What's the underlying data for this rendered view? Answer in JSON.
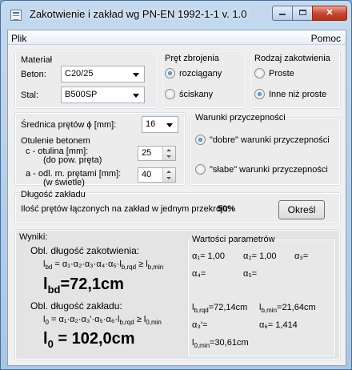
{
  "window": {
    "title": "Zakotwienie i zakład wg PN-EN 1992-1-1 v. 1.0",
    "close_glyph": "✕"
  },
  "menu": {
    "items": [
      "Plik",
      "Pomoc"
    ]
  },
  "material": {
    "title": "Materiał",
    "beton_label": "Beton:",
    "beton_value": "C20/25",
    "stal_label": "Stal:",
    "stal_value": "B500SP"
  },
  "pret": {
    "title": "Pręt zbrojenia",
    "options": [
      "rozciągany",
      "ściskany"
    ],
    "selected": 0
  },
  "rodzaj": {
    "title": "Rodzaj zakotwienia",
    "options": [
      "Proste",
      "Inne niż proste"
    ],
    "selected": 1
  },
  "srednica": {
    "label": "Średnica prętów ϕ [mm]:",
    "value": "16"
  },
  "otulenie": {
    "title": "Otulenie betonem",
    "c_label": "c - otulina [mm]:",
    "c_sub": "(do pow. pręta)",
    "c_value": "25",
    "a_label": "a - odl. m. prętami [mm]:",
    "a_sub": "(w świetle)",
    "a_value": "40"
  },
  "warunki": {
    "title": "Warunki przyczepności",
    "options": [
      "\"dobre\" warunki przyczepności",
      "\"słabe\" warunki przyczepności"
    ],
    "selected": 0
  },
  "dlugosc": {
    "title": "Długość zakładu",
    "text": "Ilość prętów łączonych na zakład w jednym przekroju:",
    "value": "50%",
    "button": "Określ"
  },
  "wyniki": {
    "title": "Wyniki:",
    "zak_title": "Obl. długość zakotwienia:",
    "zak_formula": "= α₁·α₂·α₃·α₄·α₅·l",
    "zak_result": "=72,1cm",
    "zakl_title": "Obl. długość zakładu:",
    "zakl_result": "= 102,0cm"
  },
  "parametry": {
    "title": "Wartości parametrów",
    "a1": "α₁= 1,00",
    "a2": "α₂= 1,00",
    "a3": "α₃=",
    "a4": "α₄=",
    "a5": "α₅=",
    "lbrqd": "=72,14cm",
    "lbmin": "=21,64cm",
    "a3p": "α₃'=",
    "a6": "α₆= 1,414",
    "l0min": "=30,61cm"
  }
}
